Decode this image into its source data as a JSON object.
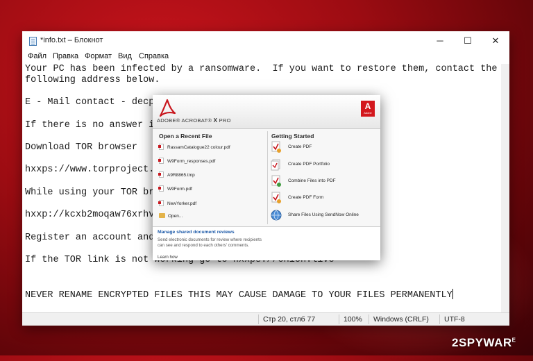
{
  "notepad": {
    "title": "*info.txt – Блокнот",
    "menu": [
      "Файл",
      "Правка",
      "Формат",
      "Вид",
      "Справка"
    ],
    "window_buttons": {
      "minimize": "─",
      "maximize": "☐",
      "close": "✕"
    },
    "lines": [
      "Your PC has been infected by a ransomware.  If you want to restore them, contact the",
      "following address below.",
      "E - Mail contact - decph",
      "If there is no answer in",
      "Download TOR browser",
      "hxxps://www.torproject.o",
      "While using your TOR bro",
      "hxxp://kcxb2moqaw76xrhv.",
      "Register an account and",
      "If the TOR link is not working go to hxxps://onion.live",
      "NEVER RENAME ENCRYPTED FILES THIS MAY CAUSE DAMAGE TO YOUR FILES PERMANENTLY"
    ],
    "status": {
      "position": "Стр 20, стлб 77",
      "zoom": "100%",
      "line_endings": "Windows (CRLF)",
      "encoding": "UTF-8"
    }
  },
  "acrobat": {
    "brand_prefix": "ADOBE® ACROBAT®",
    "brand_version": "X",
    "brand_suffix": "PRO",
    "logo_text": "Adobe",
    "recent_title": "Open a Recent File",
    "recent_files": [
      "RassamCatalogue22 colour.pdf",
      "W9Form_responses.pdf",
      "A9R8865.tmp",
      "W9Form.pdf",
      "NewYorker.pdf"
    ],
    "open_label": "Open...",
    "getting_started_title": "Getting Started",
    "getting_started": [
      {
        "label": "Create PDF",
        "icon": "create-pdf-icon"
      },
      {
        "label": "Create PDF Portfolio",
        "icon": "pdf-portfolio-icon"
      },
      {
        "label": "Combine Files into PDF",
        "icon": "combine-files-icon"
      },
      {
        "label": "Create PDF Form",
        "icon": "pdf-form-icon"
      },
      {
        "label": "Share Files Using SendNow Online",
        "icon": "share-globe-icon"
      }
    ],
    "footer": {
      "link": "Manage shared document reviews",
      "description": "Send electronic documents for review where recipients can see and respond to each others' comments.",
      "learn": "Learn how"
    }
  },
  "watermark": {
    "text": "2SPYWAR",
    "suffix": "E"
  },
  "colors": {
    "background_red": "#9c0c12",
    "adobe_red": "#d3171d",
    "link_blue": "#1d5aa8"
  }
}
